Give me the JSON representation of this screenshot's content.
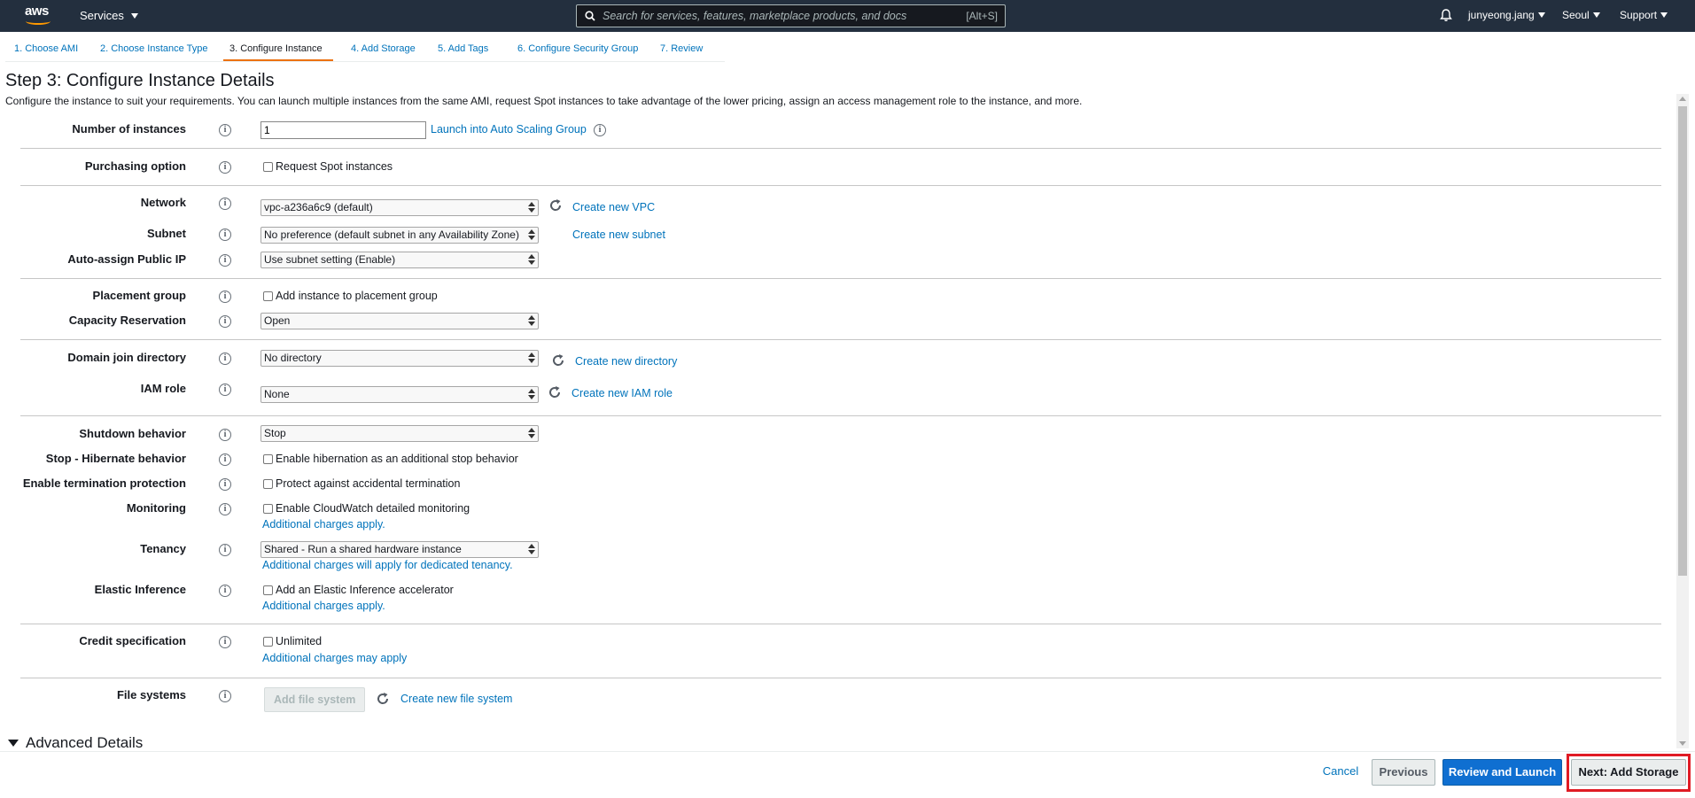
{
  "topnav": {
    "logo_text": "aws",
    "services_label": "Services",
    "search_placeholder": "Search for services, features, marketplace products, and docs",
    "search_shortcut": "[Alt+S]",
    "user_label": "junyeong.jang",
    "region_label": "Seoul",
    "support_label": "Support"
  },
  "tabs": [
    {
      "label": "1. Choose AMI"
    },
    {
      "label": "2. Choose Instance Type"
    },
    {
      "label": "3. Configure Instance"
    },
    {
      "label": "4. Add Storage"
    },
    {
      "label": "5. Add Tags"
    },
    {
      "label": "6. Configure Security Group"
    },
    {
      "label": "7. Review"
    }
  ],
  "header": {
    "title": "Step 3: Configure Instance Details",
    "description": "Configure the instance to suit your requirements. You can launch multiple instances from the same AMI, request Spot instances to take advantage of the lower pricing, assign an access management role to the instance, and more."
  },
  "form": {
    "number_of_instances": {
      "label": "Number of instances",
      "value": "1",
      "link": "Launch into Auto Scaling Group"
    },
    "purchasing_option": {
      "label": "Purchasing option",
      "checkbox": "Request Spot instances"
    },
    "network": {
      "label": "Network",
      "value": "vpc-a236a6c9 (default)",
      "link": "Create new VPC"
    },
    "subnet": {
      "label": "Subnet",
      "value": "No preference (default subnet in any Availability Zone)",
      "link": "Create new subnet"
    },
    "public_ip": {
      "label": "Auto-assign Public IP",
      "value": "Use subnet setting (Enable)"
    },
    "placement_group": {
      "label": "Placement group",
      "checkbox": "Add instance to placement group"
    },
    "capacity_reservation": {
      "label": "Capacity Reservation",
      "value": "Open"
    },
    "domain_join": {
      "label": "Domain join directory",
      "value": "No directory",
      "link": "Create new directory"
    },
    "iam_role": {
      "label": "IAM role",
      "value": "None",
      "link": "Create new IAM role"
    },
    "shutdown": {
      "label": "Shutdown behavior",
      "value": "Stop"
    },
    "hibernate": {
      "label": "Stop - Hibernate behavior",
      "checkbox": "Enable hibernation as an additional stop behavior"
    },
    "termination": {
      "label": "Enable termination protection",
      "checkbox": "Protect against accidental termination"
    },
    "monitoring": {
      "label": "Monitoring",
      "checkbox": "Enable CloudWatch detailed monitoring",
      "note": "Additional charges apply."
    },
    "tenancy": {
      "label": "Tenancy",
      "value": "Shared - Run a shared hardware instance",
      "note": "Additional charges will apply for dedicated tenancy."
    },
    "elastic_inference": {
      "label": "Elastic Inference",
      "checkbox": "Add an Elastic Inference accelerator",
      "note": "Additional charges apply."
    },
    "credit_spec": {
      "label": "Credit specification",
      "checkbox": "Unlimited",
      "note": "Additional charges may apply"
    },
    "file_systems": {
      "label": "File systems",
      "button": "Add file system",
      "link": "Create new file system"
    },
    "info_glyph": "i"
  },
  "advanced": {
    "label": "Advanced Details"
  },
  "footer": {
    "cancel": "Cancel",
    "previous": "Previous",
    "review": "Review and Launch",
    "next": "Next: Add Storage"
  }
}
